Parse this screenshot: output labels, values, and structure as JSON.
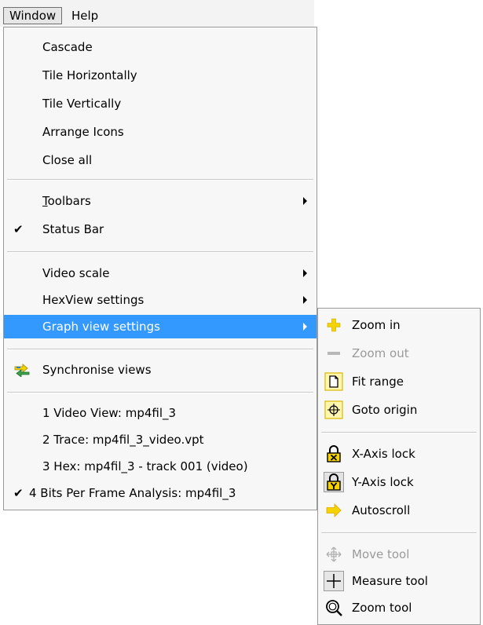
{
  "menubar": {
    "items": [
      "Window",
      "Help"
    ]
  },
  "window_menu": {
    "items": [
      {
        "label": "Cascade"
      },
      {
        "label": "Tile Horizontally"
      },
      {
        "label": "Tile Vertically"
      },
      {
        "label": "Arrange Icons"
      },
      {
        "label": "Close all"
      },
      {
        "label": "Toolbars",
        "mnemonic": "T",
        "rest": "oolbars",
        "submenu": true
      },
      {
        "label": "Status Bar",
        "checked": true
      },
      {
        "label": "Video scale",
        "submenu": true
      },
      {
        "label": "HexView settings",
        "submenu": true
      },
      {
        "label": "Graph view settings",
        "submenu": true,
        "highlighted": true
      },
      {
        "label": "Synchronise views",
        "icon": "synchronise-icon"
      },
      {
        "label": "1 Video View: mp4fil_3"
      },
      {
        "label": "2 Trace: mp4fil_3_video.vpt"
      },
      {
        "label": "3 Hex: mp4fil_3 - track 001 (video)"
      },
      {
        "label": "4 Bits Per Frame Analysis: mp4fil_3",
        "checked": true
      }
    ]
  },
  "graph_submenu": {
    "items": [
      {
        "label": "Zoom in",
        "icon": "plus-icon"
      },
      {
        "label": "Zoom out",
        "icon": "minus-icon",
        "disabled": true
      },
      {
        "label": "Fit range",
        "icon": "fit-range-icon"
      },
      {
        "label": "Goto origin",
        "icon": "goto-origin-icon"
      },
      {
        "label": "X-Axis lock",
        "icon": "x-lock-icon"
      },
      {
        "label": "Y-Axis lock",
        "icon": "y-lock-icon"
      },
      {
        "label": "Autoscroll",
        "icon": "autoscroll-arrow-icon"
      },
      {
        "label": "Move tool",
        "icon": "move-icon",
        "disabled": true
      },
      {
        "label": "Measure tool",
        "icon": "crosshair-icon"
      },
      {
        "label": "Zoom tool",
        "icon": "magnifier-icon"
      }
    ]
  },
  "colors": {
    "highlight": "#3399ff",
    "menu_bg": "#f7f7f7",
    "disabled": "#9a9a9a",
    "icon_yellow": "#f5d300"
  }
}
